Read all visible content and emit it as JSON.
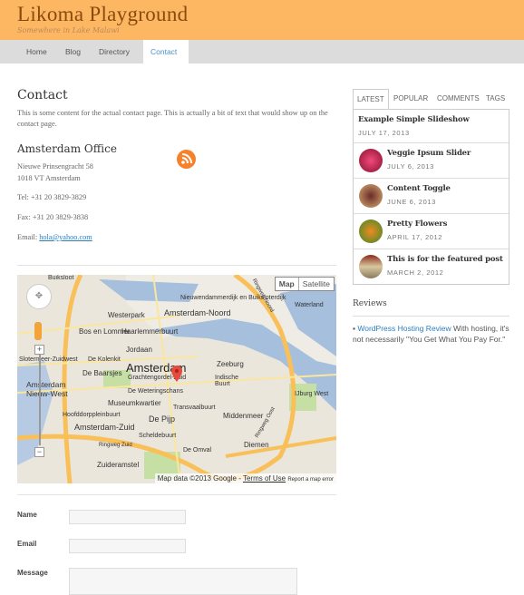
{
  "header": {
    "title": "Likoma Playground",
    "tagline": "Somewhere in Lake Malawi"
  },
  "nav": [
    {
      "label": "Home"
    },
    {
      "label": "Blog"
    },
    {
      "label": "Directory"
    },
    {
      "label": "Contact",
      "active": true
    }
  ],
  "main": {
    "title": "Contact",
    "intro": "This is some content for the actual contact page. This is actually a bit of text that would show up on the contact page.",
    "office_title": "Amsterdam Office",
    "address_line1": "Nieuwe Prinsengracht 58",
    "address_line2": "1018 VT Amsterdam",
    "tel": "Tel: +31 20 3829-3829",
    "fax": "Fax: +31 20 3829-3838",
    "email_label": "Email: ",
    "email": "hola@yahoo.com",
    "rss_icon": "rss-icon"
  },
  "map": {
    "type_buttons": [
      "Map",
      "Satellite"
    ],
    "attribution": "Map data ©2013 Google - ",
    "terms": "Terms of Use",
    "report": "Report a map error",
    "labels": [
      "Westerpark",
      "Amsterdam-Noord",
      "Nieuwendammerdijk en Buiksloterdijk",
      "Haarlemmerbuurt",
      "Bos en Lommer",
      "Jordaan",
      "De Kolenkit",
      "Slotermeer-Zuidwest",
      "Amsterdam",
      "De Baarsjes",
      "Grachtengordel-Zuid",
      "Zeeburg",
      "Indische Buurt",
      "Amsterdam Nieuw-West",
      "De Weteringschans",
      "Museumkwartier",
      "Transvaalbuurt",
      "Middenmeer",
      "Hoofddorppleinbuurt",
      "De Pijp",
      "Amsterdam-Zuid",
      "Scheldebuurt",
      "Diemen",
      "De Omval",
      "Zuideramstel",
      "Waterland",
      "IJburg West",
      "Buiksloot",
      "Ringweg Zuid",
      "Ringweg Noord",
      "Ringweg Oost"
    ],
    "colors": {
      "water": "#a5bfdd",
      "road": "#f9c05a",
      "park": "#c5dfa4",
      "land": "#eae6dc"
    }
  },
  "form": {
    "name_label": "Name",
    "email_label": "Email",
    "message_label": "Message",
    "name_value": "",
    "email_value": "",
    "message_value": ""
  },
  "sidebar": {
    "tabs": [
      {
        "label": "LATEST",
        "active": true
      },
      {
        "label": "POPULAR"
      },
      {
        "label": "COMMENTS"
      },
      {
        "label": "TAGS"
      }
    ],
    "posts": [
      {
        "title": "Example Simple Slideshow",
        "date": "JULY 17, 2013"
      },
      {
        "title": "Veggie Ipsum Slider",
        "date": "JULY 6, 2013"
      },
      {
        "title": "Content Toggle",
        "date": "JUNE 6, 2013"
      },
      {
        "title": "Pretty Flowers",
        "date": "APRIL 17, 2012"
      },
      {
        "title": "This is for the featured post",
        "date": "MARCH 2, 2012"
      }
    ],
    "reviews_title": "Reviews",
    "review_link": "WordPress Hosting Review",
    "review_text": " With hosting, it's not necessarily \"You Get What You Pay For.\""
  },
  "colors": {
    "header_bg": "#fdb763",
    "nav_bg": "#dcdcdc",
    "accent": "#4a90c8",
    "rss": "#f7812a"
  }
}
